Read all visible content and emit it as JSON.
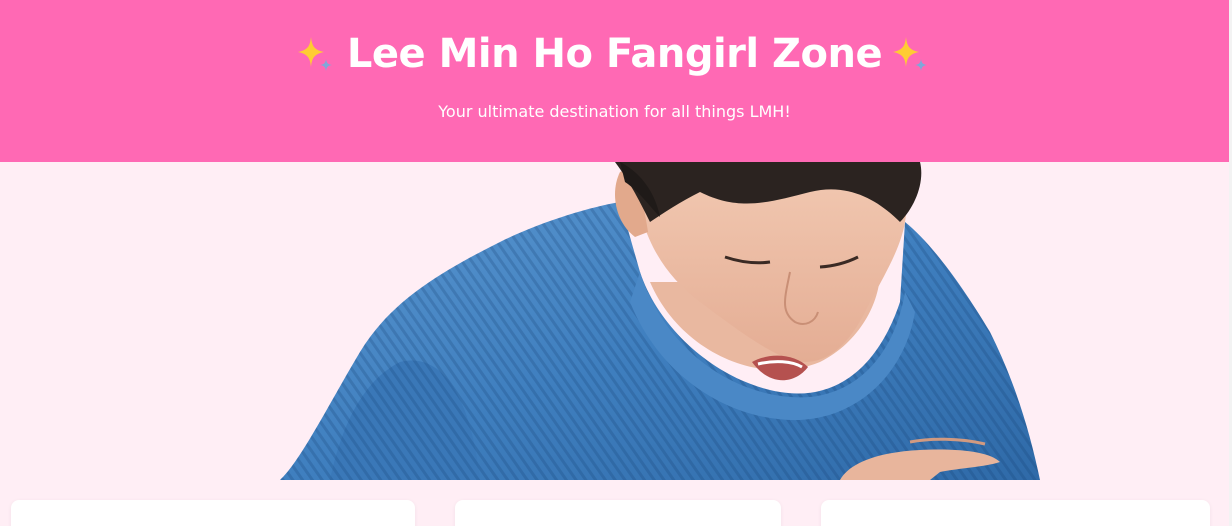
{
  "header": {
    "title": "Lee Min Ho Fangirl Zone",
    "title_icon_left": "sparkles-icon",
    "title_icon_right": "sparkles-icon",
    "subtitle": "Your ultimate destination for all things LMH!"
  },
  "hero": {
    "image": "lee-min-ho-blue-sweater-photo"
  },
  "cards": [
    "card",
    "card",
    "card"
  ],
  "colors": {
    "header_bg": "#ff69b4",
    "page_bg": "#ffeef5",
    "card_bg": "#ffffff",
    "sparkle_gold": "#ffcc33",
    "sparkle_blue": "#7fa7d9"
  }
}
